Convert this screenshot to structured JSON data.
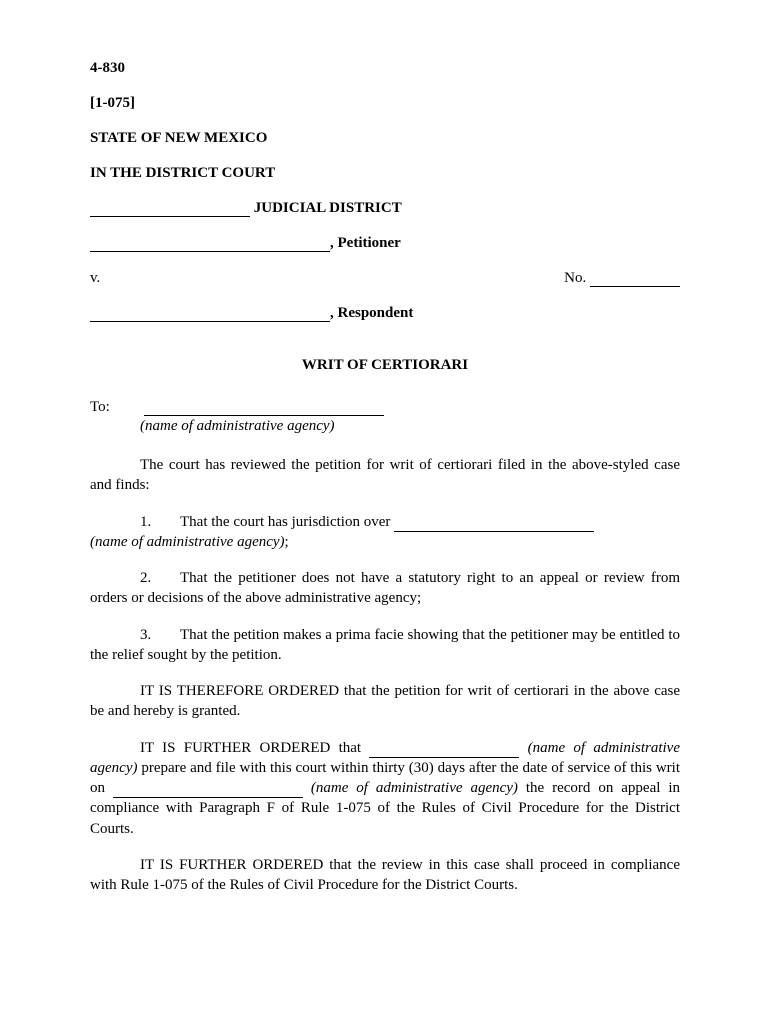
{
  "header": {
    "form_number": "4-830",
    "rule_ref": "[1-075]",
    "state": "STATE OF NEW MEXICO",
    "court": "IN THE DISTRICT COURT",
    "district_suffix": " JUDICIAL DISTRICT",
    "petitioner_suffix": ", Petitioner",
    "vs": "v.",
    "no_label": "No.",
    "respondent_suffix": ", Respondent"
  },
  "title": "WRIT OF CERTIORARI",
  "to": {
    "label": "To:",
    "hint": "(name of administrative agency)"
  },
  "intro": "The court has reviewed the petition for writ of certiorari filed in the above-styled case and finds:",
  "findings": {
    "f1_num": "1.",
    "f1_text_a": "That the court has jurisdiction over ",
    "f1_hint": "(name of administrative agency)",
    "f1_semicolon": ";",
    "f2_num": "2.",
    "f2_text": "That the petitioner does not have a statutory right to an appeal or review from orders or decisions of the above administrative agency;",
    "f3_num": "3.",
    "f3_text": "That the petition makes a prima facie showing that the petitioner may be entitled to the relief sought by the petition."
  },
  "orders": {
    "o1": "IT IS THEREFORE ORDERED that the petition for writ of certiorari in the above case be and hereby is granted.",
    "o2_a": "IT IS FURTHER ORDERED that ",
    "o2_hint1": " (name of administrative agency)",
    "o2_b": " prepare and file with this court within thirty (30) days after the date of service of this writ on ",
    "o2_hint2": " (name of administrative agency)",
    "o2_c": " the record on appeal in compliance with Paragraph F of Rule 1-075 of the Rules of Civil Procedure for the District Courts.",
    "o3": "IT IS FURTHER ORDERED that the review in this case shall proceed in compliance with Rule 1-075 of the Rules of Civil Procedure for the District Courts."
  }
}
